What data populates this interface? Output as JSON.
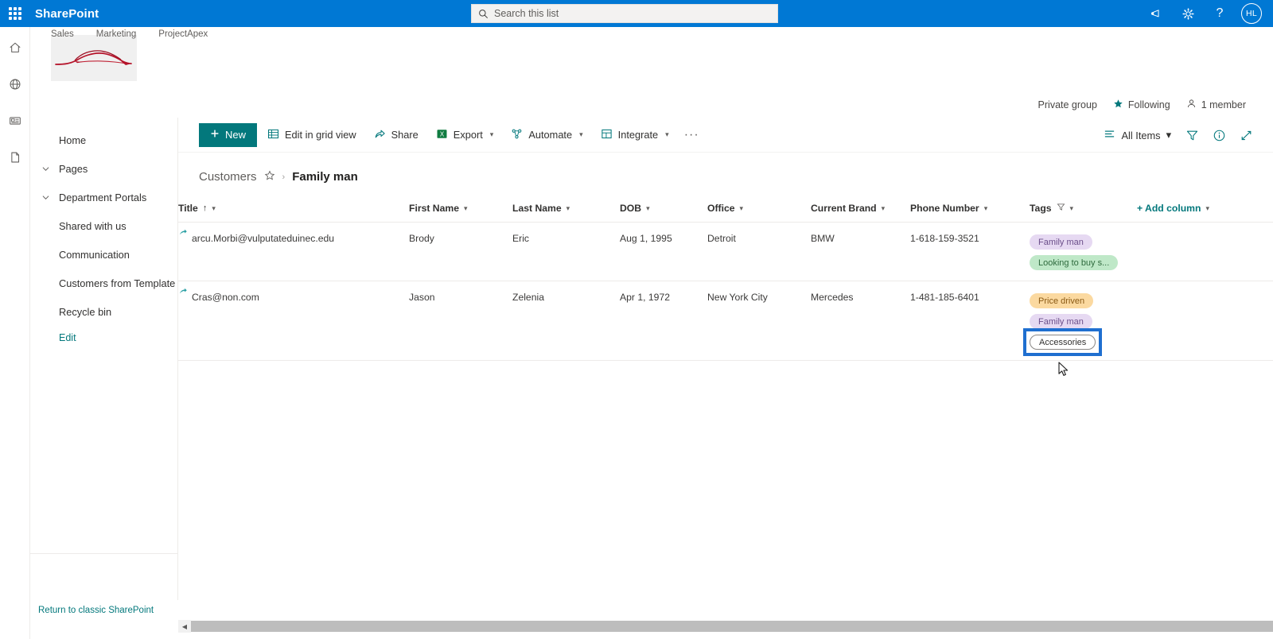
{
  "suite": {
    "brand": "SharePoint",
    "waffle_icon": "app-launcher-waffle-icon",
    "search": {
      "placeholder": "Search this list",
      "value": "",
      "icon": "search-icon"
    },
    "icons": {
      "feedback": "megaphone-icon",
      "settings": "gear-icon",
      "help": "?",
      "help_name": "help-question-icon"
    },
    "avatar_initials": "HL"
  },
  "rail": {
    "items": [
      {
        "name": "home-icon",
        "label": "Home"
      },
      {
        "name": "globe-icon",
        "label": "Web"
      },
      {
        "name": "news-icon",
        "label": "News"
      },
      {
        "name": "document-icon",
        "label": "Documents"
      }
    ]
  },
  "site": {
    "logo_alt": "car-sketch-logo",
    "topnav": [
      {
        "label": "Sales"
      },
      {
        "label": "Marketing"
      },
      {
        "label": "ProjectApex"
      }
    ]
  },
  "group_meta": {
    "privacy": "Private group",
    "following": "Following",
    "following_icon": "star-filled-icon",
    "members": "1 member",
    "members_icon": "person-icon"
  },
  "leftnav": {
    "items": [
      {
        "label": "Home",
        "expandable": false
      },
      {
        "label": "Pages",
        "expandable": true
      },
      {
        "label": "Department Portals",
        "expandable": true
      },
      {
        "label": "Shared with us",
        "expandable": false
      },
      {
        "label": "Communication",
        "expandable": false
      },
      {
        "label": "Customers from Template",
        "expandable": false
      },
      {
        "label": "Recycle bin",
        "expandable": false
      }
    ],
    "edit_label": "Edit",
    "classic_label": "Return to classic SharePoint"
  },
  "toolbar": {
    "new_label": "New",
    "new_icon": "plus-icon",
    "items": [
      {
        "label": "Edit in grid view",
        "icon": "grid-icon",
        "caret": false
      },
      {
        "label": "Share",
        "icon": "share-icon",
        "caret": false
      },
      {
        "label": "Export",
        "icon": "excel-icon",
        "caret": true
      },
      {
        "label": "Automate",
        "icon": "automate-icon",
        "caret": true
      },
      {
        "label": "Integrate",
        "icon": "integrate-icon",
        "caret": true
      }
    ],
    "overflow_label": "···",
    "view_label": "All Items",
    "view_icon": "list-view-icon",
    "filter_icon": "filter-icon",
    "info_icon": "info-icon",
    "expand_icon": "expand-diagonal-icon"
  },
  "breadcrumb": {
    "parent": "Customers",
    "star_icon": "star-outline-icon",
    "separator": "›",
    "current": "Family man"
  },
  "table": {
    "columns": [
      {
        "label": "Title",
        "sorted": true,
        "sort_arrow": "↑",
        "caret": true,
        "filtered": false
      },
      {
        "label": "First Name",
        "sorted": false,
        "caret": true,
        "filtered": false
      },
      {
        "label": "Last Name",
        "sorted": false,
        "caret": true,
        "filtered": false
      },
      {
        "label": "DOB",
        "sorted": false,
        "caret": true,
        "filtered": false
      },
      {
        "label": "Office",
        "sorted": false,
        "caret": true,
        "filtered": false
      },
      {
        "label": "Current Brand",
        "sorted": false,
        "caret": true,
        "filtered": false
      },
      {
        "label": "Phone Number",
        "sorted": false,
        "caret": true,
        "filtered": false
      },
      {
        "label": "Tags",
        "sorted": false,
        "caret": true,
        "filtered": true
      },
      {
        "label": "+ Add column",
        "sorted": false,
        "caret": true,
        "filtered": false,
        "add": true
      }
    ],
    "rows": [
      {
        "title": "arcu.Morbi@vulputateduinec.edu",
        "first_name": "Brody",
        "last_name": "Eric",
        "dob": "Aug 1, 1995",
        "office": "Detroit",
        "current_brand": "BMW",
        "phone_number": "1-618-159-3521",
        "tags": [
          {
            "label": "Family man",
            "bg": "#e6d9f2",
            "fg": "#6b4e8a",
            "style": "filled"
          },
          {
            "label": "Looking to buy s...",
            "bg": "#bfe8c8",
            "fg": "#2f6b3e",
            "style": "filled"
          }
        ]
      },
      {
        "title": "Cras@non.com",
        "first_name": "Jason",
        "last_name": "Zelenia",
        "dob": "Apr 1, 1972",
        "office": "New York City",
        "current_brand": "Mercedes",
        "phone_number": "1-481-185-6401",
        "tags": [
          {
            "label": "Price driven",
            "bg": "#fbd9a0",
            "fg": "#8a5a15",
            "style": "filled"
          },
          {
            "label": "Family man",
            "bg": "#e6d9f2",
            "fg": "#6b4e8a",
            "style": "filled"
          },
          {
            "label": "Accessories",
            "bg": "#ffffff",
            "fg": "#323130",
            "style": "outline",
            "focused": true
          }
        ]
      }
    ]
  },
  "colors": {
    "suite_blue": "#0078d4",
    "accent_teal": "#03787c",
    "focus_blue": "#1f6fd0",
    "logo_red": "#b5132a"
  }
}
